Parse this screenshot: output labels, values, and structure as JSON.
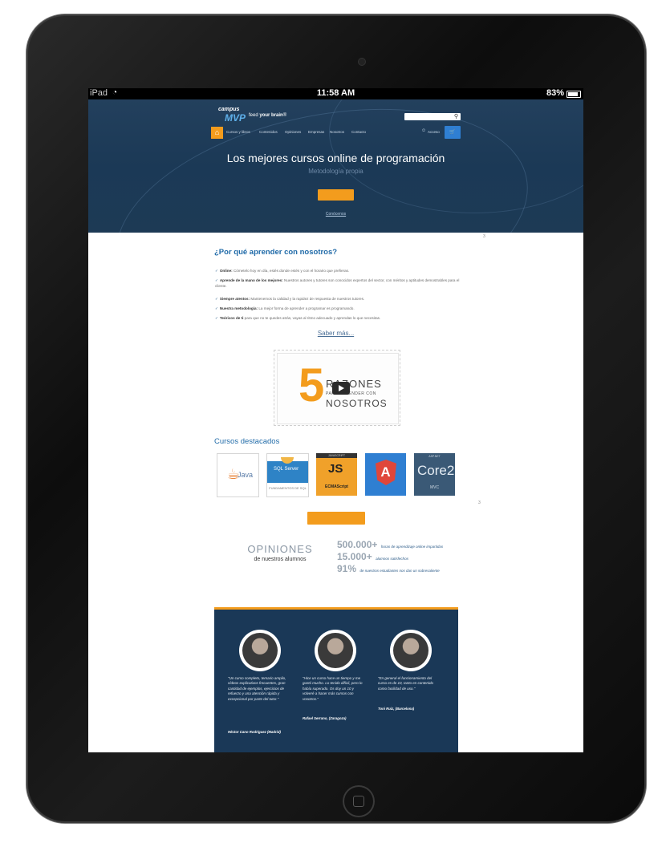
{
  "device": {
    "status_bar": {
      "device": "iPad",
      "time": "11:58 AM",
      "battery": "83%"
    }
  },
  "header": {
    "logo_line1": "campus",
    "logo_line2": "MVP",
    "tagline_pre": "feed ",
    "tagline_bold": "your brain",
    "tagline_post": "®",
    "search_placeholder": "",
    "access_label": "Acceso",
    "nav_items": [
      "Cursos y libros",
      "Contenidos",
      "Opiniones",
      "Empresas",
      "Nosotros",
      "Contacto"
    ]
  },
  "hero": {
    "title": "Los mejores cursos online de programación",
    "subtitle": "Metodología propia",
    "link": "Conócenos"
  },
  "why": {
    "title": "¿Por qué aprender con nosotros?",
    "bullets": [
      {
        "bold": "Online:",
        "text": " Cómetelo hoy en día, estés donde estés y con el horario que prefieras."
      },
      {
        "bold": "Aprende de la mano de los mejores:",
        "text": " Nuestros autores y tutores son conocidos expertos del sector, con méritos y aptitudes demostrables para el cliente."
      },
      {
        "bold": "Siempre atentos:",
        "text": " Mantenemos la calidad y la rapidez de respuesta de nuestros tutores."
      },
      {
        "bold": "Nuestra metodología:",
        "text": " La mejor forma de aprender a programar es programando."
      },
      {
        "bold": "Teóricos de ti",
        "text": " para que no te quedes atrás, vayas al ritmo adecuado y aprendas lo que necesitas."
      }
    ],
    "learn_more": "Saber más..."
  },
  "video": {
    "number": "5",
    "line1": "RAZONES",
    "line2": "PARA APRENDER CON",
    "line3": "NOSOTROS"
  },
  "featured": {
    "title": "Cursos destacados",
    "courses": [
      {
        "name": "Java"
      },
      {
        "name": "SQL Server",
        "caption": "FUNDAMENTOS DE SQL"
      },
      {
        "top": "JAVASCRIPT",
        "name": "JS",
        "caption": "ECMAScript"
      },
      {
        "name": "A"
      },
      {
        "top": "ASP.NET",
        "name": "Core2",
        "caption": "MVC"
      }
    ]
  },
  "markers": {
    "a": "3",
    "b": "3"
  },
  "opinions": {
    "title": "OPINIONES",
    "subtitle": "de nuestros alumnos",
    "stats": [
      {
        "value": "500.000+",
        "label": "horas de aprendizaje online impartidas"
      },
      {
        "value": "15.000+",
        "label": "alumnos satisfechos"
      },
      {
        "value": "91%",
        "label": "de nuestros estudiantes nos dan un sobresaliente"
      }
    ]
  },
  "testimonials": [
    {
      "quote": "\"Un curso completo, temario amplio, vídeos explicativos frecuentes, gran cantidad de ejemplos, ejercicios de refuerzo y una atención rápida y excepcional por parte del tutor.\"",
      "author": "Héctor Cano Rodríguez (Madrid)"
    },
    {
      "quote": "\"Hice un curso hace un tiempo y me gustó mucho. Lo tenido difícil, pero lo había superado. Os doy un 10 y volveré a hacer más cursos con vosotros.\"",
      "author": "Rafael Serrano, (Zaragoza)"
    },
    {
      "quote": "\"En general el funcionamiento del curso es de 10, tanto en contenido como facilidad de uso.\"",
      "author": "Toni Ruiz, (Barcelona)"
    }
  ]
}
